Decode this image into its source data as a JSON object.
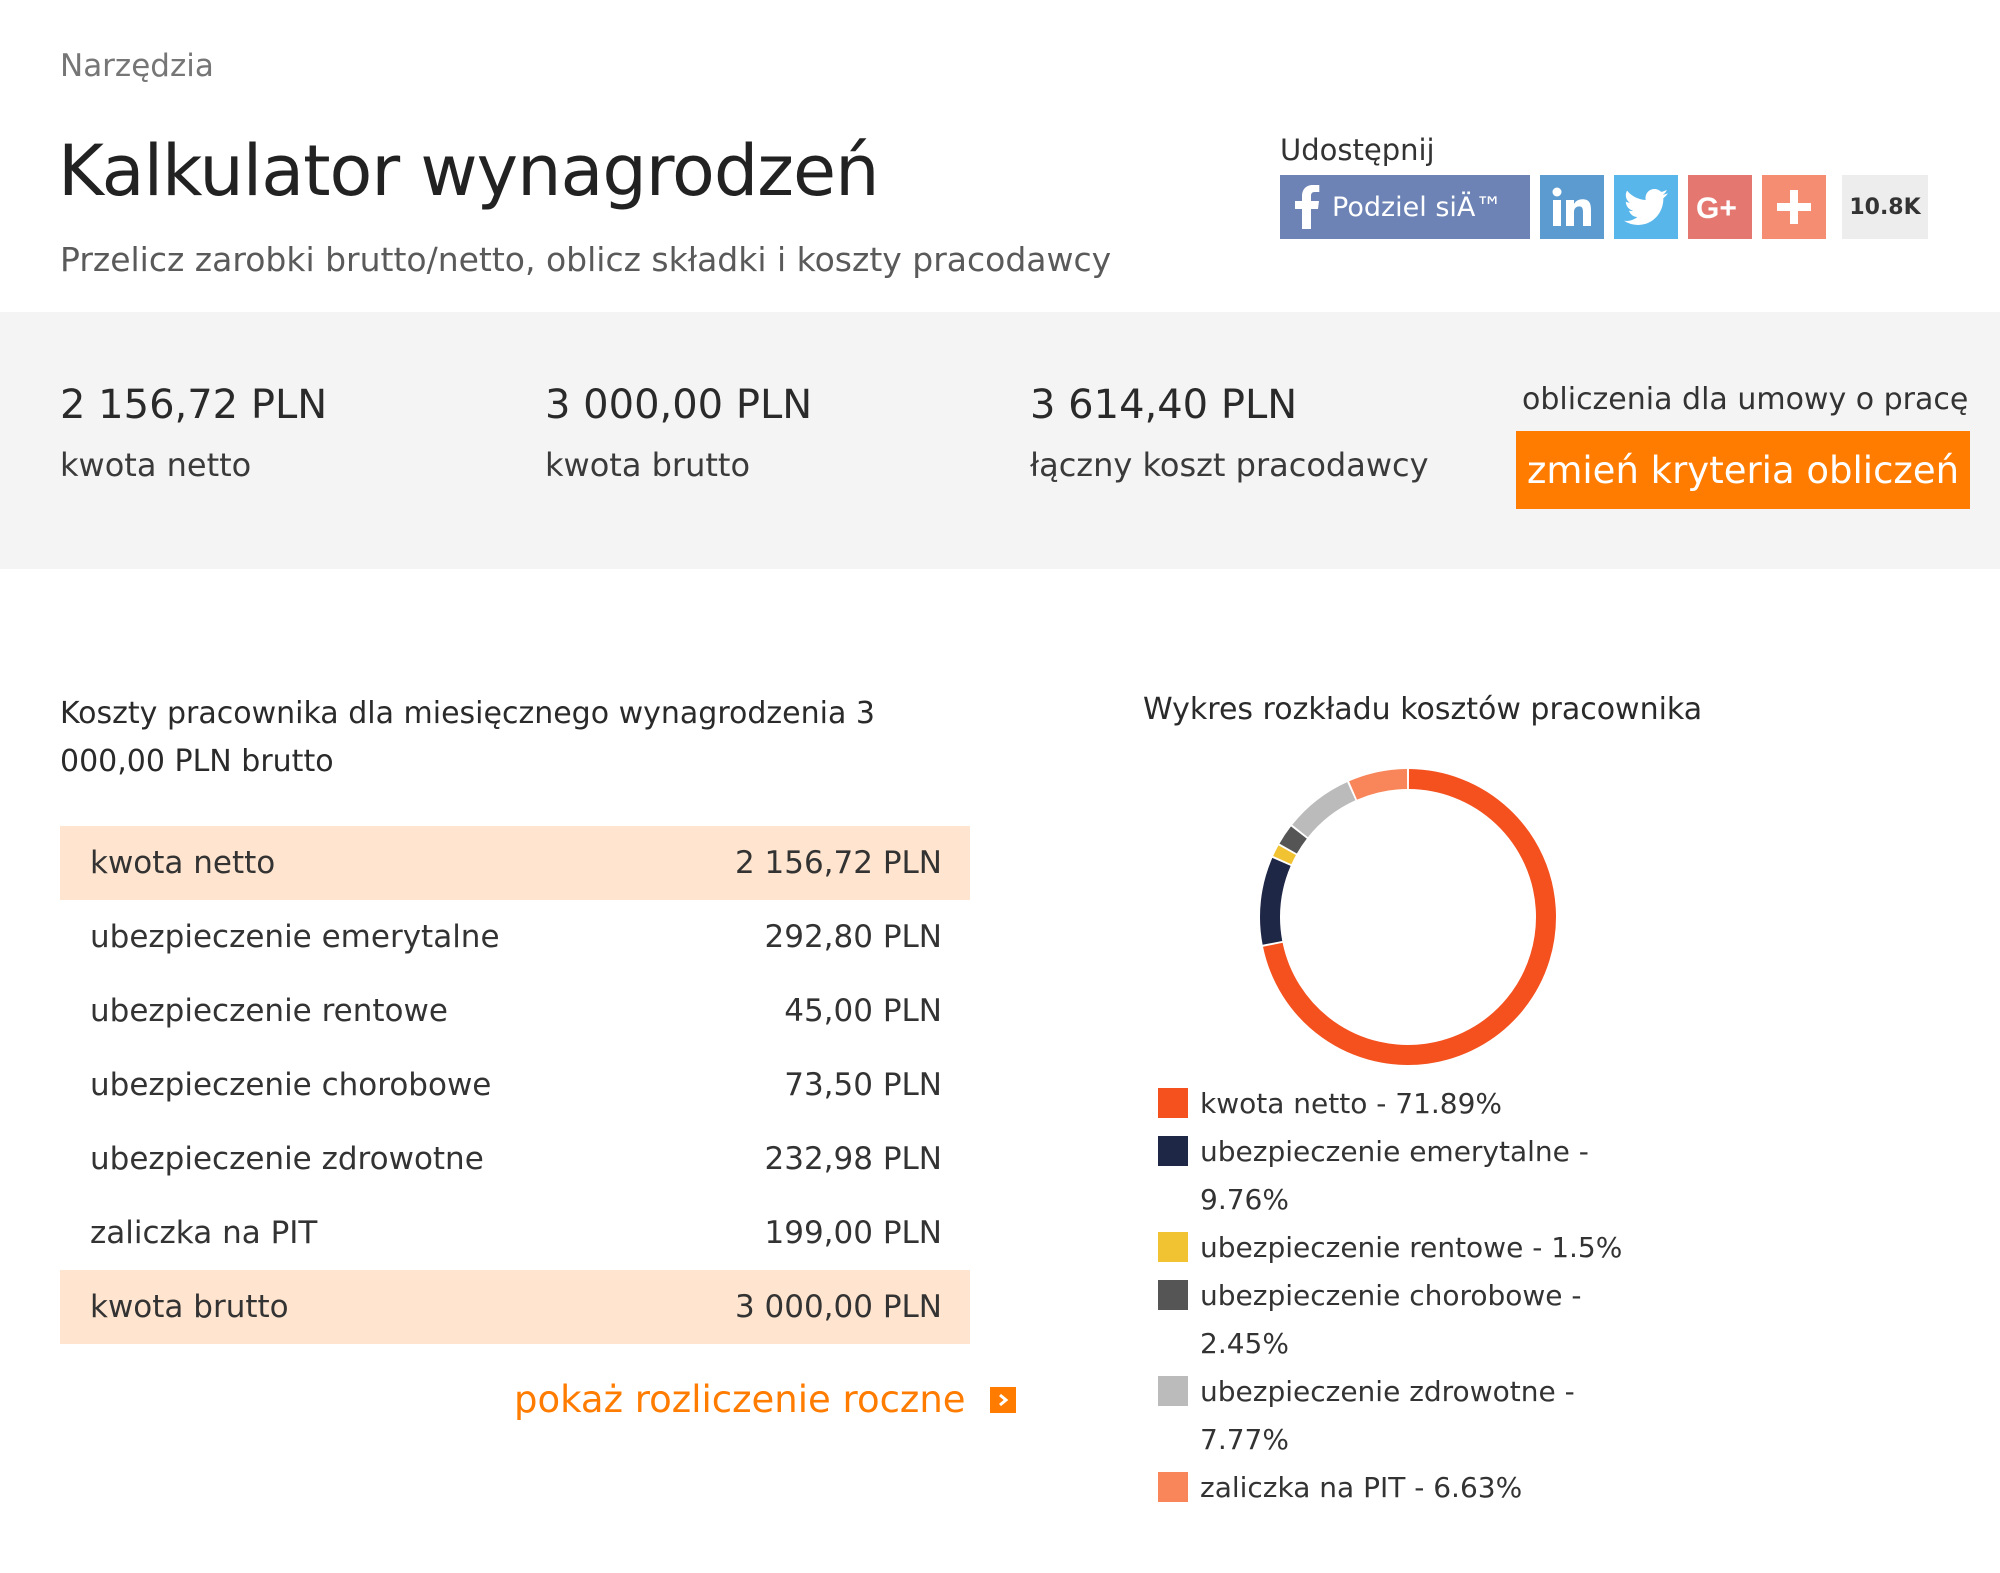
{
  "breadcrumb": "Narzędzia",
  "title": "Kalkulator wynagrodzeń",
  "subtitle": "Przelicz zarobki brutto/netto, oblicz składki i koszty pracodawcy",
  "share": {
    "label": "Udostępnij",
    "facebook_label": "Podziel siÄ™",
    "count": "10.8K"
  },
  "summary": {
    "net_value": "2 156,72 PLN",
    "net_label": "kwota netto",
    "gross_value": "3 000,00 PLN",
    "gross_label": "kwota brutto",
    "employer_value": "3 614,40 PLN",
    "employer_label": "łączny koszt pracodawcy",
    "contract_note": "obliczenia dla umowy o pracę",
    "change_button": "zmień kryteria obliczeń"
  },
  "table": {
    "title": "Koszty pracownika dla miesięcznego wynagrodzenia 3 000,00 PLN brutto",
    "rows": [
      {
        "label": "kwota netto",
        "value": "2 156,72 PLN"
      },
      {
        "label": "ubezpieczenie emerytalne",
        "value": "292,80 PLN"
      },
      {
        "label": "ubezpieczenie rentowe",
        "value": "45,00 PLN"
      },
      {
        "label": "ubezpieczenie chorobowe",
        "value": "73,50 PLN"
      },
      {
        "label": "ubezpieczenie zdrowotne",
        "value": "232,98 PLN"
      },
      {
        "label": "zaliczka na PIT",
        "value": "199,00 PLN"
      },
      {
        "label": "kwota brutto",
        "value": "3 000,00 PLN"
      }
    ],
    "annual_link": "pokaż rozliczenie roczne"
  },
  "chart_title": "Wykres rozkładu kosztów pracownika",
  "chart_data": {
    "type": "pie",
    "title": "Wykres rozkładu kosztów pracownika",
    "legend_position": "bottom",
    "slices": [
      {
        "label": "kwota netto - 71.89%",
        "value": 71.89,
        "color": "#f4511e"
      },
      {
        "label": "ubezpieczenie emerytalne - 9.76%",
        "value": 9.76,
        "color": "#1f2747"
      },
      {
        "label": "ubezpieczenie rentowe - 1.5%",
        "value": 1.5,
        "color": "#f1c232"
      },
      {
        "label": "ubezpieczenie chorobowe - 2.45%",
        "value": 2.45,
        "color": "#555555"
      },
      {
        "label": "ubezpieczenie zdrowotne - 7.77%",
        "value": 7.77,
        "color": "#bbbbbb"
      },
      {
        "label": "zaliczka na PIT - 6.63%",
        "value": 6.63,
        "color": "#f9855a"
      }
    ]
  },
  "colors": {
    "accent": "#ff7c00",
    "highlight_row": "#ffe5cf",
    "summary_bg": "#f4f4f4"
  }
}
